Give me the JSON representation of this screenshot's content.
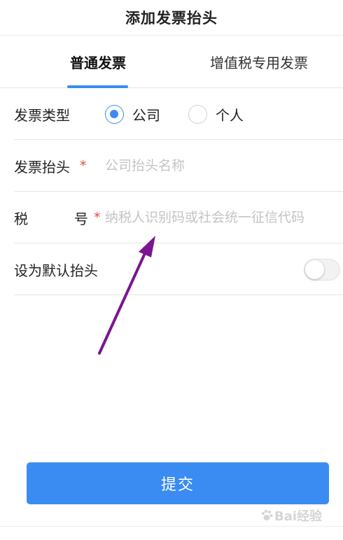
{
  "header": {
    "title": "添加发票抬头"
  },
  "tabs": [
    {
      "label": "普通发票",
      "active": true
    },
    {
      "label": "增值税专用发票",
      "active": false
    }
  ],
  "form": {
    "invoice_type": {
      "label": "发票类型",
      "options": [
        {
          "label": "公司",
          "checked": true
        },
        {
          "label": "个人",
          "checked": false
        }
      ]
    },
    "invoice_title": {
      "label": "发票抬头",
      "required_mark": "*",
      "value": "",
      "placeholder": "公司抬头名称"
    },
    "tax_number": {
      "label_left": "税",
      "label_right": "号",
      "required_mark": "*",
      "value": "",
      "placeholder": "纳税人识别码或社会统一征信代码"
    },
    "default_title": {
      "label": "设为默认抬头",
      "enabled": false
    }
  },
  "submit_label": "提交",
  "watermark": {
    "text": "Bai经验"
  },
  "colors": {
    "accent": "#3b8cf2",
    "required": "#e64a3b",
    "arrow": "#7a1590"
  }
}
